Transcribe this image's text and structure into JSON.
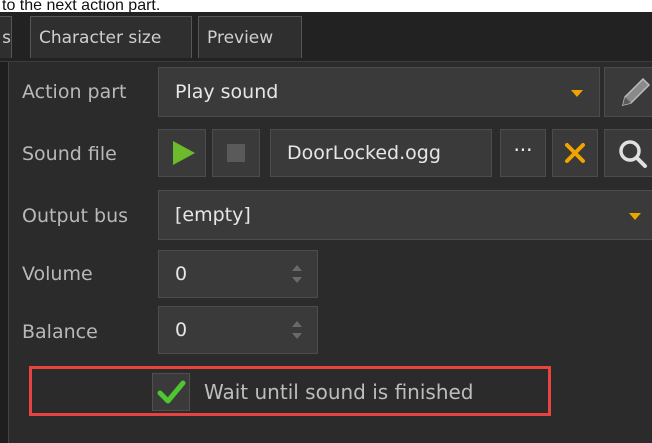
{
  "caption": {
    "text": "to the next action part."
  },
  "tabs": [
    {
      "label": "s"
    },
    {
      "label": "Character size"
    },
    {
      "label": "Preview"
    }
  ],
  "form": {
    "action_part": {
      "label": "Action part",
      "value": "Play sound"
    },
    "sound_file": {
      "label": "Sound file",
      "value": "DoorLocked.ogg",
      "browse_label": "···"
    },
    "output_bus": {
      "label": "Output bus",
      "value": "[empty]"
    },
    "volume": {
      "label": "Volume",
      "value": "0"
    },
    "balance": {
      "label": "Balance",
      "value": "0"
    },
    "wait_checkbox": {
      "label": "Wait until sound is finished",
      "checked": true
    }
  },
  "colors": {
    "accent_orange": "#f0a400",
    "play_green": "#6dbb2c",
    "check_green": "#4fc531",
    "highlight_red": "#e8433f"
  },
  "icons": [
    "pencil-icon",
    "play-icon",
    "stop-icon",
    "clear-icon",
    "search-icon",
    "checkmark-icon"
  ]
}
